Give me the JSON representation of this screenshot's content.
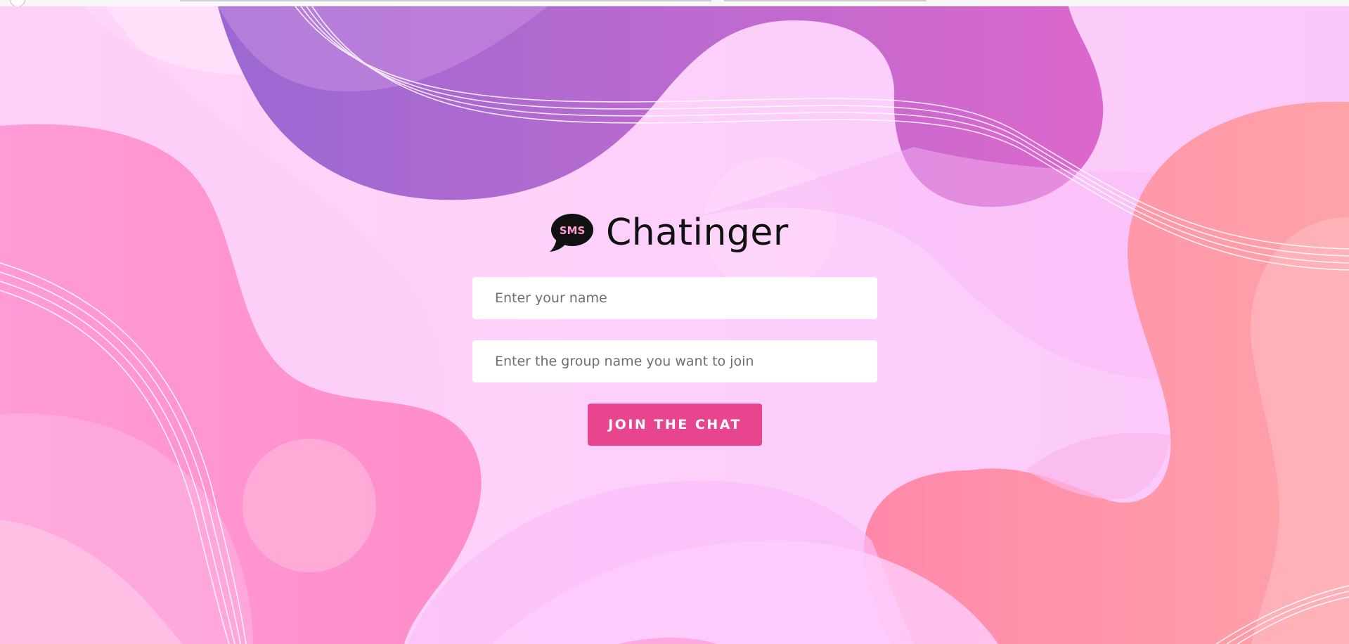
{
  "app": {
    "title": "Chatinger",
    "icon_text": "SMS",
    "icon": "speech-bubble-icon"
  },
  "form": {
    "name_placeholder": "Enter your name",
    "group_placeholder": "Enter the group name you want to join",
    "join_label": "JOIN THE CHAT"
  },
  "colors": {
    "background": "#fdd3fb",
    "accent": "#e8458f",
    "blob_purple": "#b06ad0",
    "blob_pink": "#ff8fcf",
    "blob_coral": "#ff9aa8",
    "field_background": "#ffffff"
  }
}
